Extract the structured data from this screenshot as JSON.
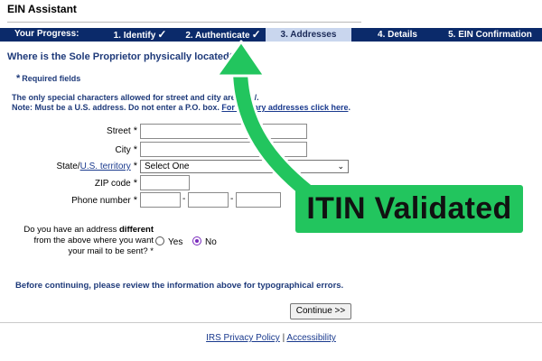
{
  "app": {
    "title": "EIN Assistant"
  },
  "progress": {
    "label": "Your Progress:",
    "steps": [
      {
        "label": "1. Identify",
        "done": true
      },
      {
        "label": "2. Authenticate",
        "done": true
      },
      {
        "label": "3. Addresses",
        "active": true
      },
      {
        "label": "4. Details"
      },
      {
        "label": "5. EIN Confirmation"
      }
    ],
    "check": "✓"
  },
  "page": {
    "question": "Where is the Sole Proprietor physically located?",
    "required_note": "Required fields",
    "required_star": "*",
    "note1": "The only special characters allowed for street and city are and /.",
    "note2_prefix": "Note: Must be a U.S. address. Do not enter a P.O. box.",
    "note2_link": "For military addresses click here",
    "note2_suffix": "."
  },
  "form": {
    "street_label": "Street",
    "city_label": "City",
    "state_label_prefix": "State/",
    "state_label_link": "U.S. territory",
    "state_selected": "Select One",
    "zip_label": "ZIP code",
    "phone_label": "Phone number",
    "star": "*",
    "dash": "-",
    "street_value": "",
    "city_value": "",
    "zip_value": "",
    "phone_1": "",
    "phone_2": "",
    "phone_3": ""
  },
  "address_question": {
    "line1_prefix": "Do you have an address",
    "line1_bold": "different",
    "line2": "from the above where you want",
    "line3": "your mail to be sent?",
    "yes_label": "Yes",
    "no_label": "No",
    "selected": "No"
  },
  "review_note": "Before continuing, please review the information above for typographical errors.",
  "continue_label": "Continue >>",
  "footer": {
    "privacy_link": "IRS Privacy Policy",
    "separator": "|",
    "accessibility_link": "Accessibility"
  },
  "callout": {
    "text": "ITIN Validated",
    "color": "#22c55e"
  }
}
